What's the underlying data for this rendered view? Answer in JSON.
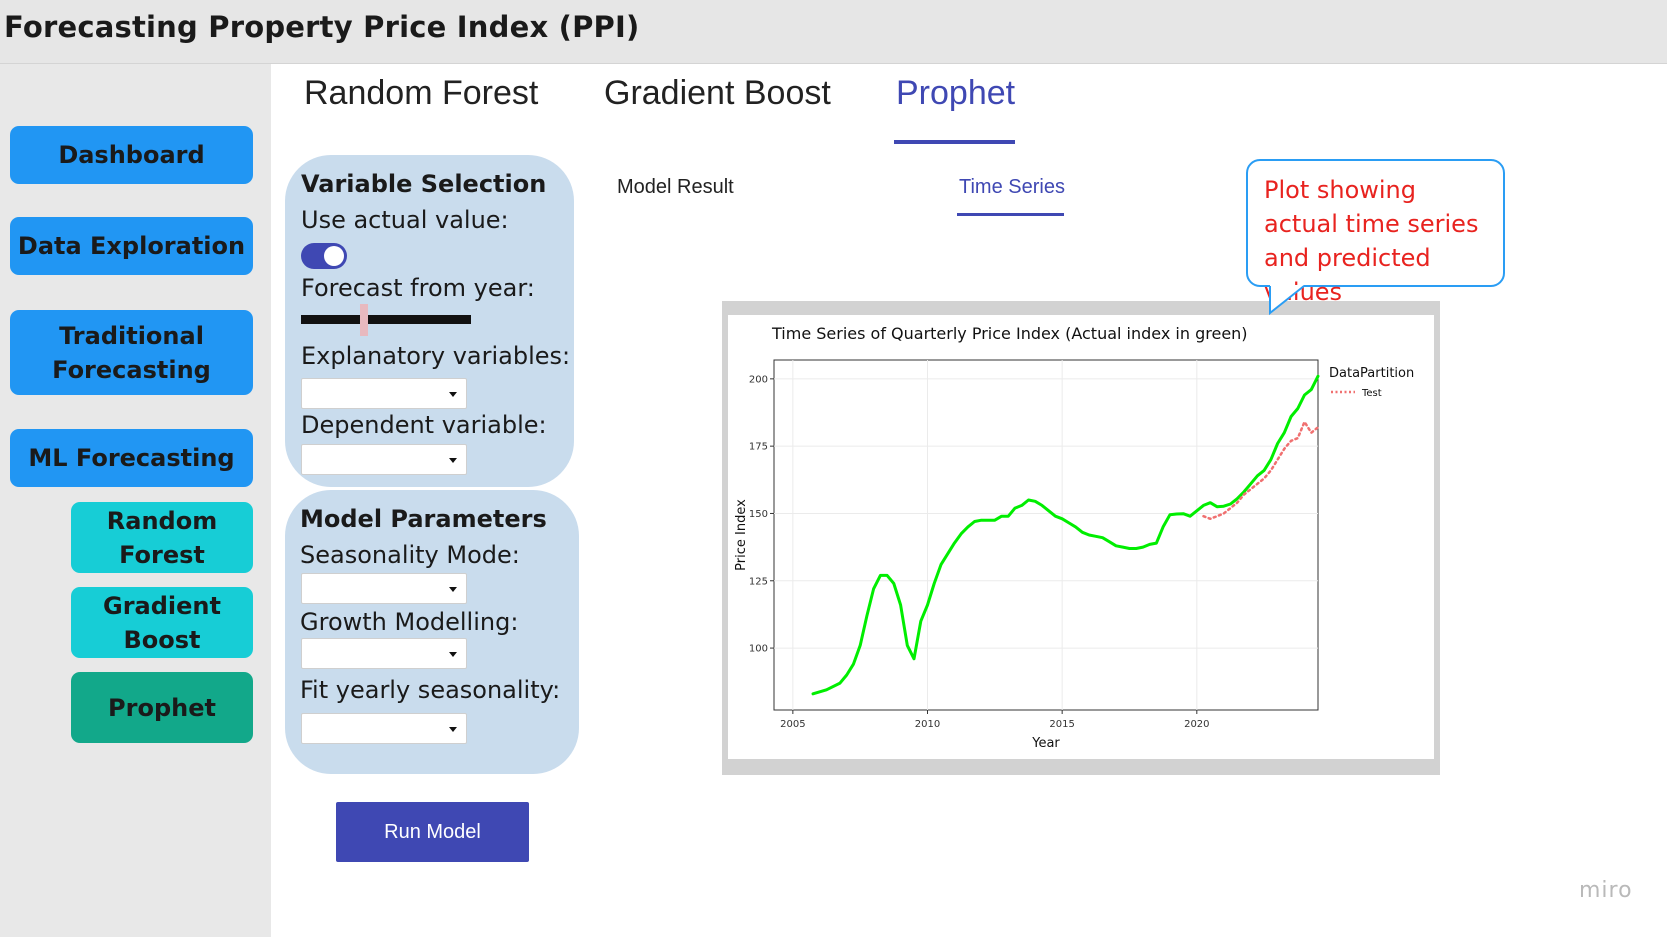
{
  "app": {
    "title": "Forecasting Property Price Index (PPI)"
  },
  "sidebar": {
    "items": [
      {
        "label": "Dashboard"
      },
      {
        "label": "Data Exploration"
      },
      {
        "label": "Traditional Forecasting"
      },
      {
        "label": "ML Forecasting"
      },
      {
        "label": "Random Forest"
      },
      {
        "label": "Gradient Boost"
      },
      {
        "label": "Prophet"
      }
    ]
  },
  "model_tabs": [
    {
      "label": "Random Forest"
    },
    {
      "label": "Gradient Boost"
    },
    {
      "label": "Prophet",
      "active": true
    }
  ],
  "sub_tabs": [
    {
      "label": "Model Result"
    },
    {
      "label": "Time Series",
      "active": true
    }
  ],
  "variable_selection": {
    "title": "Variable Selection",
    "use_actual_label": "Use actual value:",
    "use_actual_value": true,
    "forecast_year_label": "Forecast from year:",
    "forecast_year_level": 0.37,
    "explanatory_label": "Explanatory variables:",
    "dependent_label": "Dependent variable:"
  },
  "model_parameters": {
    "title": "Model Parameters",
    "seasonality_label": "Seasonality Mode:",
    "growth_label": "Growth Modelling:",
    "yearly_label": "Fit yearly seasonality:"
  },
  "run_button": {
    "label": "Run Model"
  },
  "callout": {
    "text": "Plot showing actual time series and predicted values"
  },
  "watermark": "miro",
  "colors": {
    "accent": "#3f48b3",
    "nav_blue": "#2196f3",
    "nav_teal": "#17cdd6",
    "nav_green": "#12a88a",
    "actual_line": "#00ee00",
    "test_line": "#f07070",
    "callout_text": "#e8231f"
  },
  "chart_data": {
    "type": "line",
    "title": "Time Series of Quarterly Price Index (Actual index in green)",
    "xlabel": "Year",
    "ylabel": "Price Index",
    "xlim": [
      2004.3,
      2024.5
    ],
    "ylim": [
      77,
      207
    ],
    "xticks": [
      2005,
      2010,
      2015,
      2020
    ],
    "yticks": [
      100,
      125,
      150,
      175,
      200
    ],
    "grid": true,
    "legend": {
      "title": "DataPartition",
      "entries": [
        "Test"
      ],
      "position": "right"
    },
    "series": [
      {
        "role": "actual",
        "color": "#00ee00",
        "style": "solid",
        "points": [
          [
            2005.75,
            83
          ],
          [
            2006.25,
            84.5
          ],
          [
            2006.75,
            87
          ],
          [
            2007.0,
            90
          ],
          [
            2007.25,
            94
          ],
          [
            2007.5,
            101
          ],
          [
            2007.75,
            112
          ],
          [
            2008.0,
            122
          ],
          [
            2008.25,
            127
          ],
          [
            2008.5,
            127
          ],
          [
            2008.75,
            124
          ],
          [
            2009.0,
            116
          ],
          [
            2009.25,
            101
          ],
          [
            2009.5,
            96
          ],
          [
            2009.75,
            110
          ],
          [
            2010.0,
            116
          ],
          [
            2010.25,
            124
          ],
          [
            2010.5,
            131
          ],
          [
            2010.75,
            135
          ],
          [
            2011.0,
            139
          ],
          [
            2011.25,
            142.5
          ],
          [
            2011.5,
            145
          ],
          [
            2011.75,
            147
          ],
          [
            2012.0,
            147.5
          ],
          [
            2012.25,
            147.5
          ],
          [
            2012.5,
            147.5
          ],
          [
            2012.75,
            149
          ],
          [
            2013.0,
            149
          ],
          [
            2013.25,
            152
          ],
          [
            2013.5,
            153
          ],
          [
            2013.75,
            155
          ],
          [
            2014.0,
            154.5
          ],
          [
            2014.25,
            153
          ],
          [
            2014.5,
            151
          ],
          [
            2014.75,
            149
          ],
          [
            2015.0,
            148
          ],
          [
            2015.25,
            146.5
          ],
          [
            2015.5,
            145
          ],
          [
            2015.75,
            143
          ],
          [
            2016.0,
            142
          ],
          [
            2016.25,
            141.5
          ],
          [
            2016.5,
            141
          ],
          [
            2016.75,
            139.5
          ],
          [
            2017.0,
            138
          ],
          [
            2017.25,
            137.5
          ],
          [
            2017.5,
            137
          ],
          [
            2017.75,
            137
          ],
          [
            2018.0,
            137.5
          ],
          [
            2018.25,
            138.5
          ],
          [
            2018.5,
            139
          ],
          [
            2018.75,
            145
          ],
          [
            2019.0,
            149.5
          ],
          [
            2019.25,
            149.8
          ],
          [
            2019.5,
            149.9
          ],
          [
            2019.75,
            149
          ],
          [
            2020.0,
            151
          ],
          [
            2020.25,
            153
          ],
          [
            2020.5,
            154
          ],
          [
            2020.75,
            152.5
          ],
          [
            2021.0,
            152.7
          ],
          [
            2021.25,
            153.5
          ],
          [
            2021.5,
            155.5
          ],
          [
            2021.75,
            158
          ],
          [
            2022.0,
            161
          ],
          [
            2022.25,
            164
          ],
          [
            2022.5,
            166
          ],
          [
            2022.75,
            170
          ],
          [
            2023.0,
            176
          ],
          [
            2023.25,
            180
          ],
          [
            2023.5,
            186
          ],
          [
            2023.75,
            189
          ],
          [
            2024.0,
            194
          ],
          [
            2024.25,
            196
          ],
          [
            2024.5,
            201
          ]
        ]
      },
      {
        "name": "Test",
        "role": "test",
        "color": "#f07070",
        "style": "dotted",
        "points": [
          [
            2020.25,
            149
          ],
          [
            2020.5,
            148
          ],
          [
            2020.75,
            149
          ],
          [
            2021.0,
            150
          ],
          [
            2021.25,
            152
          ],
          [
            2021.5,
            154
          ],
          [
            2021.75,
            157
          ],
          [
            2022.0,
            159
          ],
          [
            2022.25,
            161
          ],
          [
            2022.5,
            163
          ],
          [
            2022.75,
            166
          ],
          [
            2023.0,
            170
          ],
          [
            2023.25,
            174
          ],
          [
            2023.5,
            177
          ],
          [
            2023.75,
            178
          ],
          [
            2024.0,
            184
          ],
          [
            2024.25,
            180
          ],
          [
            2024.5,
            182
          ]
        ]
      }
    ]
  }
}
